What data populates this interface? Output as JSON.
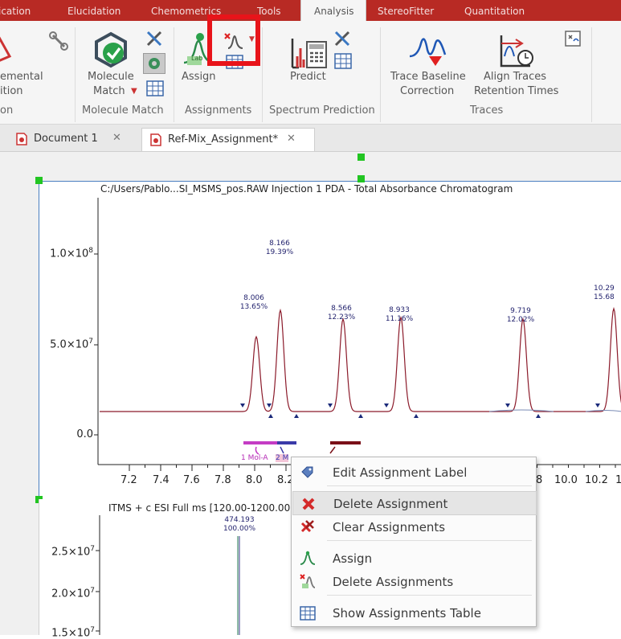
{
  "ribbon_tabs": [
    "ication",
    "Elucidation",
    "Chemometrics",
    "Tools",
    "Analysis",
    "StereoFitter",
    "Quantitation"
  ],
  "ribbon": {
    "partial_left": {
      "line1": "emental",
      "line2": "ition",
      "group": "on"
    },
    "molecule_match": {
      "line1": "Molecule",
      "line2": "Match",
      "group": "Molecule Match"
    },
    "assign": {
      "label": "Assign",
      "group": "Assignments",
      "mini_label": "Lab"
    },
    "predict": {
      "label": "Predict",
      "group": "Spectrum Prediction"
    },
    "trace_baseline": {
      "line1": "Trace Baseline",
      "line2": "Correction"
    },
    "align_traces": {
      "line1": "Align Traces",
      "line2": "Retention Times"
    },
    "traces_group": "Traces",
    "colors": {
      "tab_bar": "#b82a24",
      "highlight_box": "#e8141a"
    }
  },
  "doc_tabs": [
    {
      "label": "Document 1",
      "active": false
    },
    {
      "label": "Ref-Mix_Assignment*",
      "active": true
    }
  ],
  "plot1": {
    "title": "C:/Users/Pablo...SI_MSMS_pos.RAW Injection 1  PDA - Total Absorbance Chromatogram",
    "y_ticks": [
      {
        "mant": "1.0×10",
        "exp": "8"
      },
      {
        "mant": "5.0×10",
        "exp": "7"
      },
      {
        "mant": "0.0",
        "exp": ""
      }
    ],
    "x_ticks": [
      "7.2",
      "7.4",
      "7.6",
      "7.8",
      "8.0",
      "8.2",
      "8",
      "10.0",
      "10.2",
      "1"
    ],
    "peaks": [
      {
        "rt": "8.006",
        "pct": "13.65%"
      },
      {
        "rt": "8.166",
        "pct": "19.39%"
      },
      {
        "rt": "8.566",
        "pct": "12.23%"
      },
      {
        "rt": "8.933",
        "pct": "11.16%"
      },
      {
        "rt": "9.719",
        "pct": "12.02%"
      },
      {
        "rt": "10.29",
        "pct": "15.68"
      }
    ],
    "assign_labels": [
      "1 Mol-A",
      "2 M"
    ]
  },
  "plot2": {
    "title": "ITMS + c ESI Full ms [120.00-1200.00",
    "peak": {
      "mz": "474.193",
      "pct": "100.00%"
    },
    "y_ticks": [
      {
        "mant": "2.5×10",
        "exp": "7"
      },
      {
        "mant": "2.0×10",
        "exp": "7"
      },
      {
        "mant": "1.5×10",
        "exp": "7"
      }
    ]
  },
  "context_menu": {
    "items": [
      {
        "label": "Edit Assignment Label",
        "icon": "tag-icon"
      },
      {
        "label": "Delete Assignment",
        "icon": "red-x-icon"
      },
      {
        "label": "Clear Assignments",
        "icon": "clear-x-icon"
      },
      {
        "label": "Assign",
        "icon": "assign-peak-icon"
      },
      {
        "label": "Delete Assignments",
        "icon": "delete-assign-icon"
      },
      {
        "label": "Show Assignments Table",
        "icon": "table-icon"
      }
    ]
  }
}
